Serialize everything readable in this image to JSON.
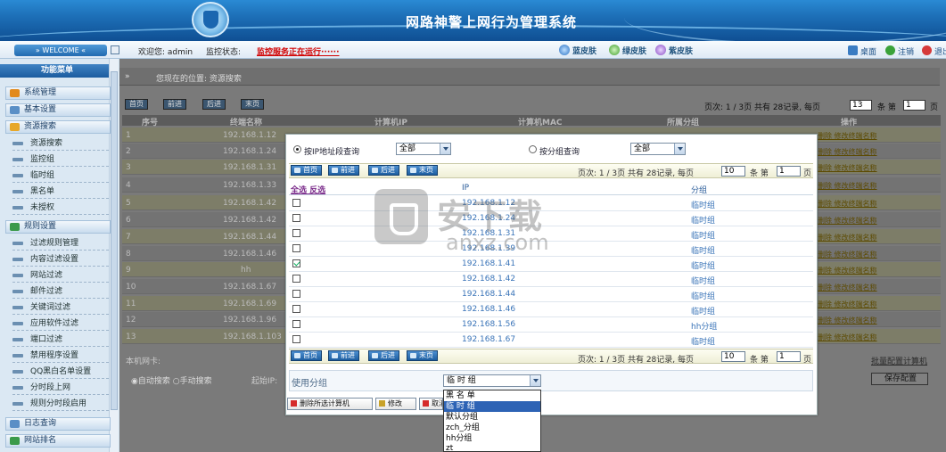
{
  "header": {
    "title": "网路神警上网行为管理系统",
    "welcome_tab": "» WELCOME «",
    "greeting": "欢迎您: admin",
    "monitor_label": "监控状态:",
    "monitor_status": "监控服务正在运行······",
    "skins": [
      "蓝皮肤",
      "绿皮肤",
      "紫皮肤"
    ],
    "links": [
      "桌面",
      "注销",
      "退出"
    ]
  },
  "sidebar": {
    "title": "功能菜单",
    "sections": [
      {
        "label": "系统管理",
        "items": []
      },
      {
        "label": "基本设置",
        "items": []
      },
      {
        "label": "资源搜索",
        "items": [
          "资源搜索",
          "监控组",
          "临时组",
          "黑名单",
          "未授权"
        ]
      },
      {
        "label": "规则设置",
        "items": [
          "过滤规则管理",
          "内容过滤设置",
          "网站过滤",
          "邮件过滤",
          "关键词过滤",
          "应用软件过滤",
          "端口过滤",
          "禁用程序设置",
          "QQ黑白名单设置",
          "分时段上网",
          "规则分时段启用"
        ]
      },
      {
        "label": "日志查询",
        "items": []
      },
      {
        "label": "网站排名",
        "items": []
      }
    ]
  },
  "main": {
    "location": "您现在的位置: 资源搜索",
    "nav_buttons": [
      "首页",
      "前进",
      "后进",
      "末页"
    ],
    "pager": "页次: 1 / 3页 共有 28记录, 每页",
    "per_page": "13",
    "page_label": "条 第",
    "page_no": "1",
    "page_suffix": "页",
    "columns": [
      "序号",
      "终端名称",
      "计算机IP",
      "计算机MAC",
      "所属分组",
      "操作"
    ],
    "rows": [
      {
        "no": "1",
        "name": "192.168.1.12"
      },
      {
        "no": "2",
        "name": "192.168.1.24"
      },
      {
        "no": "3",
        "name": "192.168.1.31"
      },
      {
        "no": "4",
        "name": "192.168.1.33"
      },
      {
        "no": "5",
        "name": "192.168.1.42"
      },
      {
        "no": "6",
        "name": "192.168.1.42"
      },
      {
        "no": "7",
        "name": "192.168.1.44"
      },
      {
        "no": "8",
        "name": "192.168.1.46"
      },
      {
        "no": "9",
        "name": "hh"
      },
      {
        "no": "10",
        "name": "192.168.1.67"
      },
      {
        "no": "11",
        "name": "192.168.1.69"
      },
      {
        "no": "12",
        "name": "192.168.1.96"
      },
      {
        "no": "13",
        "name": "192.168.1.103"
      }
    ],
    "row_actions": "删除 修改终端名称",
    "machine_label": "本机网卡:",
    "search_mode": "◉自动搜索 ○手动搜索",
    "start_label": "起始IP:",
    "batch_link": "批量配置计算机",
    "save_button": "保存配置"
  },
  "modal": {
    "filter_ip_label": "按IP地址段查询",
    "filter_ip_value": "全部",
    "filter_group_label": "按分组查询",
    "filter_group_value": "全部",
    "nav_buttons": [
      "首页",
      "前进",
      "后进",
      "末页"
    ],
    "pager": "页次: 1 / 3页 共有 28记录, 每页",
    "per_page": "10",
    "page_label": "条 第",
    "page_no": "1",
    "page_suffix": "页",
    "select_all": "全选 反选",
    "columns": [
      "IP",
      "分组"
    ],
    "rows": [
      {
        "ip": "192.168.1.12",
        "group": "临时组",
        "checked": false
      },
      {
        "ip": "192.168.1.24",
        "group": "临时组",
        "checked": false
      },
      {
        "ip": "192.168.1.31",
        "group": "临时组",
        "checked": false
      },
      {
        "ip": "192.168.1.39",
        "group": "临时组",
        "checked": false
      },
      {
        "ip": "192.168.1.41",
        "group": "临时组",
        "checked": true
      },
      {
        "ip": "192.168.1.42",
        "group": "临时组",
        "checked": false
      },
      {
        "ip": "192.168.1.44",
        "group": "临时组",
        "checked": false
      },
      {
        "ip": "192.168.1.46",
        "group": "临时组",
        "checked": false
      },
      {
        "ip": "192.168.1.56",
        "group": "hh分组",
        "checked": false
      },
      {
        "ip": "192.168.1.67",
        "group": "临时组",
        "checked": false
      }
    ],
    "use_group_label": "使用分组",
    "group_select_value": "临 时 组",
    "group_options": [
      "黑 名 单",
      "临 时 组",
      "默认分组",
      "zch_分组",
      "hh分组",
      "zt"
    ],
    "group_selected_index": 1,
    "delete_button": "删除所选计算机",
    "edit_button": "修改",
    "cancel_button": "取消"
  },
  "watermark": {
    "cn": "安下载",
    "en": "anxz.com"
  },
  "colors": {
    "banner": "#1d6fb7",
    "status_red": "#d10000",
    "link_blue": "#3a74b8",
    "dropdown_selected": "#2d63b5"
  }
}
